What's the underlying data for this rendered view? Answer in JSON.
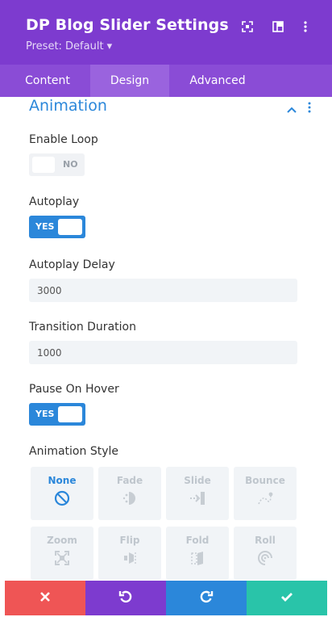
{
  "header": {
    "title": "DP Blog Slider Settings",
    "preset": "Preset: Default ▾",
    "icons": [
      "expand-icon",
      "columns-icon",
      "more-vertical-icon"
    ]
  },
  "tabs": [
    {
      "label": "Content",
      "active": false
    },
    {
      "label": "Design",
      "active": true
    },
    {
      "label": "Advanced",
      "active": false
    }
  ],
  "section": {
    "title": "Animation",
    "icons": [
      "chevron-up-icon",
      "more-vertical-icon"
    ]
  },
  "fields": {
    "enable_loop": {
      "label": "Enable Loop",
      "value": "NO"
    },
    "autoplay": {
      "label": "Autoplay",
      "value": "YES"
    },
    "autoplay_delay": {
      "label": "Autoplay Delay",
      "value": "3000"
    },
    "transition_duration": {
      "label": "Transition Duration",
      "value": "1000"
    },
    "pause_on_hover": {
      "label": "Pause On Hover",
      "value": "YES"
    }
  },
  "animation_style": {
    "label": "Animation Style",
    "options": [
      {
        "label": "None",
        "icon": "none-icon",
        "selected": true
      },
      {
        "label": "Fade",
        "icon": "fade-icon",
        "selected": false
      },
      {
        "label": "Slide",
        "icon": "slide-icon",
        "selected": false
      },
      {
        "label": "Bounce",
        "icon": "bounce-icon",
        "selected": false
      },
      {
        "label": "Zoom",
        "icon": "zoom-icon",
        "selected": false
      },
      {
        "label": "Flip",
        "icon": "flip-icon",
        "selected": false
      },
      {
        "label": "Fold",
        "icon": "fold-icon",
        "selected": false
      },
      {
        "label": "Roll",
        "icon": "roll-icon",
        "selected": false
      }
    ]
  },
  "footer_buttons": [
    {
      "name": "close-button",
      "icon": "close-icon",
      "color": "#ef5555"
    },
    {
      "name": "undo-button",
      "icon": "undo-icon",
      "color": "#7d3bcf"
    },
    {
      "name": "redo-button",
      "icon": "redo-icon",
      "color": "#2b87da"
    },
    {
      "name": "save-button",
      "icon": "check-icon",
      "color": "#29c4a9"
    }
  ],
  "colors": {
    "header": "#7d3bcf",
    "tabs": "#8a4cd6",
    "active_tab": "#9a63de",
    "accent": "#2b87da"
  }
}
